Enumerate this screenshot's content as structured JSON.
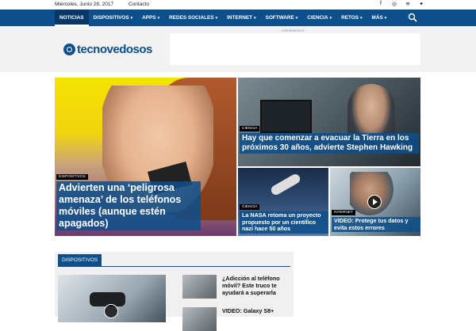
{
  "topbar": {
    "date": "Miércoles, Junio 28, 2017",
    "contact": "Contacto",
    "social": [
      "facebook-icon",
      "instagram-icon",
      "rss-icon",
      "twitter-icon"
    ]
  },
  "nav": {
    "items": [
      {
        "label": "NOTICIAS",
        "caret": ""
      },
      {
        "label": "DISPOSITIVOS",
        "caret": "▾"
      },
      {
        "label": "APPS",
        "caret": "▾"
      },
      {
        "label": "REDES SOCIALES",
        "caret": "▾"
      },
      {
        "label": "INTERNET",
        "caret": "▾"
      },
      {
        "label": "SOFTWARE",
        "caret": "▾"
      },
      {
        "label": "CIENCIA",
        "caret": "▾"
      },
      {
        "label": "RETOS",
        "caret": "▾"
      },
      {
        "label": "MÁS",
        "caret": "▾"
      }
    ],
    "search_icon": "search-icon"
  },
  "header": {
    "logo_text": "tecnovedosos",
    "ad_label": "- Advertisement -"
  },
  "featured": [
    {
      "category": "DISPOSITIVOS",
      "title": "Advierten una ‘peligrosa amenaza’ de los teléfonos móviles (aunque estén apagados)"
    },
    {
      "category": "CIENCIA",
      "title": "Hay que comenzar a evacuar la Tierra en los próximos 30 años, advierte Stephen Hawking"
    },
    {
      "category": "CIENCIA",
      "title": "La NASA retoma un proyecto propuesto por un científico nazi hace 50 años"
    },
    {
      "category": "INTERNET",
      "title": "VIDEO: Protege tus datos y evita estos errores"
    }
  ],
  "section": {
    "tab": "DISPOSITIVOS",
    "side_items": [
      {
        "title": "¿Adicción al teléfono móvil? Este truco te ayudará a superarla"
      },
      {
        "title": "VIDEO: Galaxy S8+"
      }
    ]
  },
  "colors": {
    "brand": "#0d4f8b",
    "nav_active": "#063766"
  }
}
